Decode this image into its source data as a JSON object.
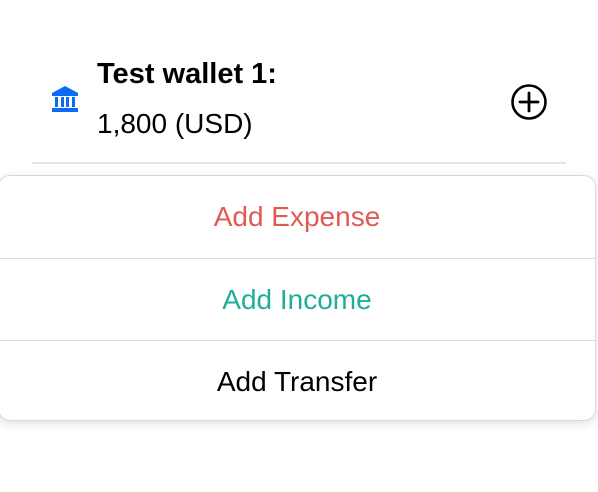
{
  "wallet": {
    "icon": "bank-icon",
    "name": "Test wallet 1:",
    "balance": "1,800 (USD)",
    "add_icon": "add-circle-icon"
  },
  "menu": {
    "items": [
      {
        "label": "Add Expense",
        "color": "#e05a55"
      },
      {
        "label": "Add Income",
        "color": "#1fae97"
      },
      {
        "label": "Add Transfer",
        "color": "#000000"
      }
    ]
  },
  "colors": {
    "accent": "#0a6cf5",
    "divider": "#e4e4e4"
  }
}
